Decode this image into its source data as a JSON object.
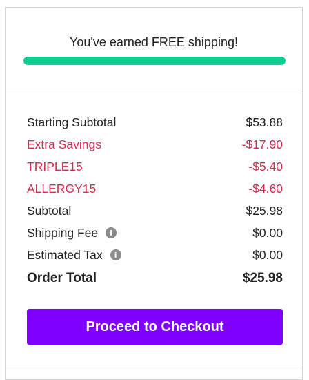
{
  "shipping": {
    "message": "You've earned FREE shipping!",
    "progress_percent": 100,
    "progress_color": "#11cc90"
  },
  "summary": {
    "rows": [
      {
        "label": "Starting Subtotal",
        "value": "$53.88"
      },
      {
        "label": "Extra Savings",
        "value": "-$17.90"
      },
      {
        "label": "TRIPLE15",
        "value": "-$5.40"
      },
      {
        "label": "ALLERGY15",
        "value": "-$4.60"
      },
      {
        "label": "Subtotal",
        "value": "$25.98"
      },
      {
        "label": "Shipping Fee",
        "value": "$0.00"
      },
      {
        "label": "Estimated Tax",
        "value": "$0.00"
      }
    ],
    "total_label": "Order Total",
    "total_value": "$25.98"
  },
  "checkout": {
    "label": "Proceed to Checkout",
    "color": "#8000ff"
  },
  "colors": {
    "discount": "#d82c4f",
    "info_icon": "#8a8a8a"
  },
  "icons": {
    "info": "info-icon"
  }
}
